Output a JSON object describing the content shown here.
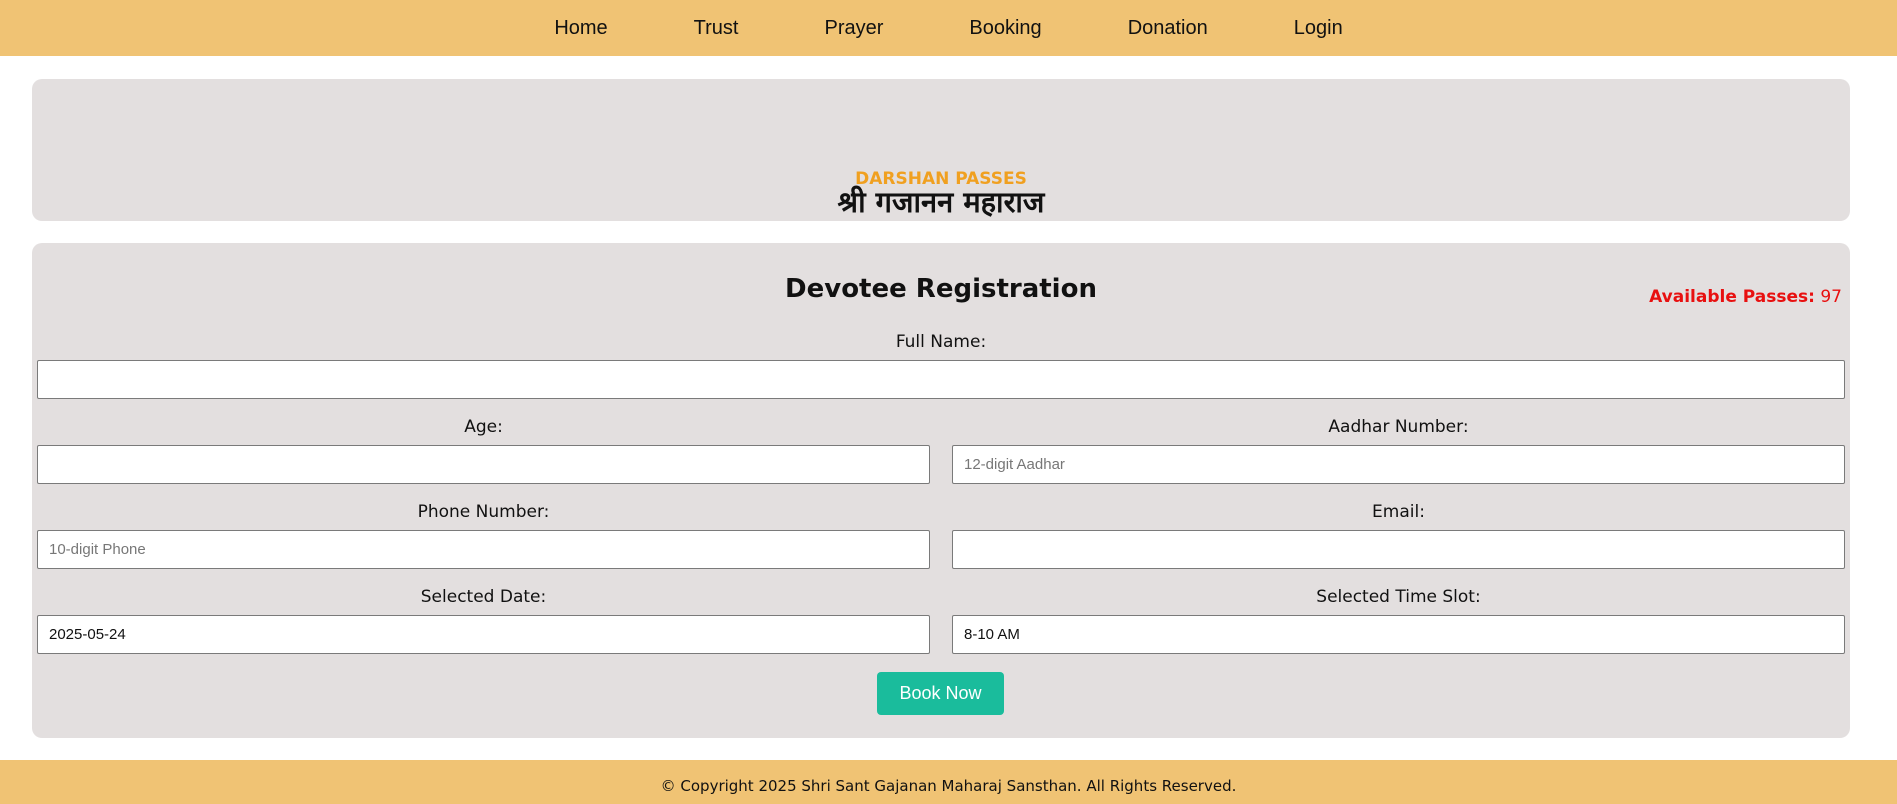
{
  "nav": {
    "items": [
      {
        "label": "Home"
      },
      {
        "label": "Trust"
      },
      {
        "label": "Prayer"
      },
      {
        "label": "Booking"
      },
      {
        "label": "Donation"
      },
      {
        "label": "Login"
      }
    ]
  },
  "hero": {
    "title": "श्री गजानन महाराज",
    "subtitle": "DARSHAN PASSES",
    "subtitle_color": "#f0a020"
  },
  "form": {
    "title": "Devotee Registration",
    "available": {
      "label": "Available Passes:",
      "count": "97",
      "color": "#e81010"
    },
    "fields": {
      "full_name": {
        "label": "Full Name:",
        "value": "",
        "placeholder": ""
      },
      "age": {
        "label": "Age:",
        "value": "",
        "placeholder": ""
      },
      "aadhar": {
        "label": "Aadhar Number:",
        "value": "",
        "placeholder": "12-digit Aadhar"
      },
      "phone": {
        "label": "Phone Number:",
        "value": "",
        "placeholder": "10-digit Phone"
      },
      "email": {
        "label": "Email:",
        "value": "",
        "placeholder": ""
      },
      "date": {
        "label": "Selected Date:",
        "value": "2025-05-24",
        "placeholder": ""
      },
      "time_slot": {
        "label": "Selected Time Slot:",
        "value": "8-10 AM",
        "placeholder": ""
      }
    },
    "submit_label": "Book Now",
    "submit_color": "#1abc9c"
  },
  "footer": {
    "text": "© Copyright 2025 Shri Sant Gajanan Maharaj Sansthan. All Rights Reserved."
  },
  "theme": {
    "header_bg": "#f0c374",
    "card_bg": "#e3dfdf"
  }
}
